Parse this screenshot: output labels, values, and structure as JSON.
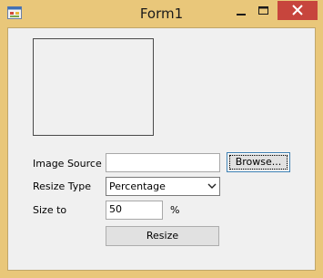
{
  "window": {
    "title": "Form1",
    "icons": {
      "app": "form-app-icon",
      "minimize": "minimize-icon",
      "maximize": "maximize-icon",
      "close": "close-icon"
    }
  },
  "form": {
    "image_source_label": "Image Source",
    "image_source_value": "",
    "browse_label": "Browse...",
    "resize_type_label": "Resize Type",
    "resize_type_selected": "Percentage",
    "size_to_label": "Size to",
    "size_to_value": "50",
    "percent_sign": "%",
    "resize_button_label": "Resize"
  },
  "colors": {
    "window_frame": "#e9c77a",
    "close_button": "#c7453d",
    "client_bg": "#f0f0f0"
  }
}
